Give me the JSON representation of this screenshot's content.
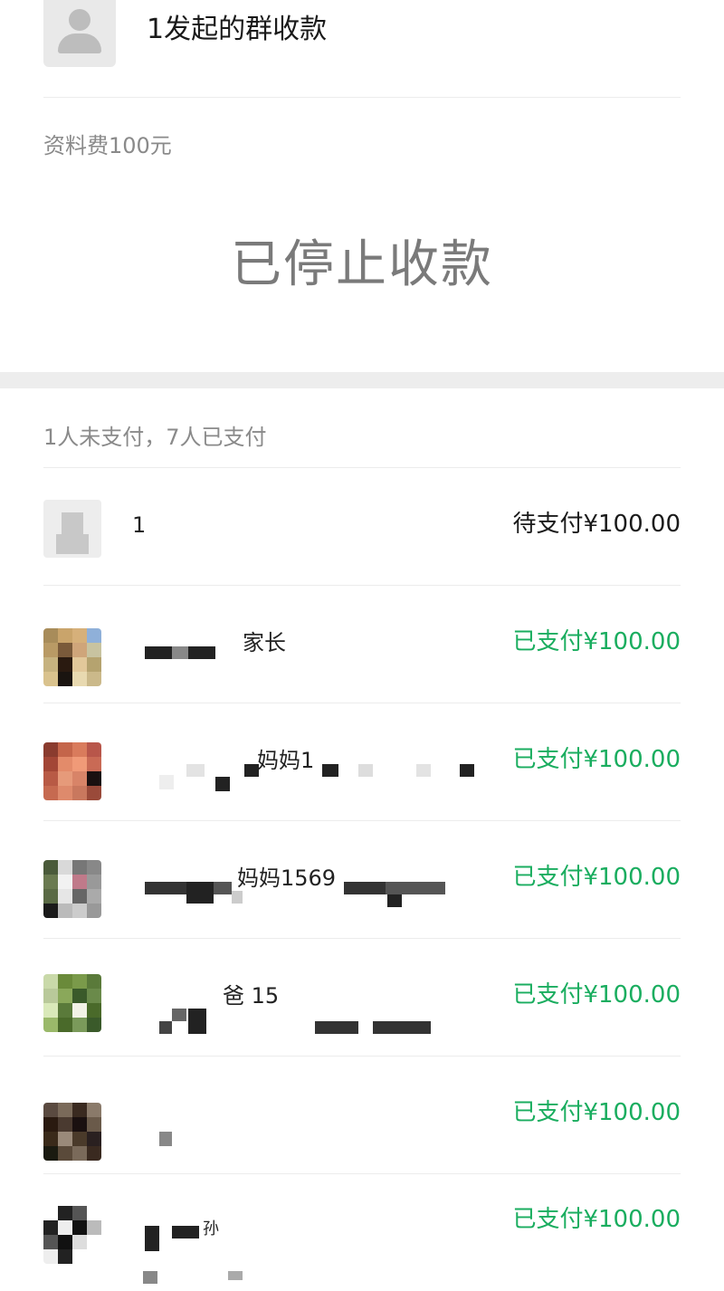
{
  "header": {
    "title": "1发起的群收款",
    "avatar_icon": "default-avatar-icon"
  },
  "collection": {
    "note": "资料费100元",
    "status": "已停止收款"
  },
  "summary": "1人未支付，7人已支付",
  "members": [
    {
      "name": "1",
      "amount": "待支付¥100.00",
      "state": "pending"
    },
    {
      "name": "家长",
      "amount": "已支付¥100.00",
      "state": "paid"
    },
    {
      "name": "妈妈1",
      "amount": "已支付¥100.00",
      "state": "paid"
    },
    {
      "name": "妈妈1569",
      "amount": "已支付¥100.00",
      "state": "paid"
    },
    {
      "name": "爸 15",
      "amount": "已支付¥100.00",
      "state": "paid"
    },
    {
      "name": "",
      "amount": "已支付¥100.00",
      "state": "paid"
    },
    {
      "name": "孙",
      "amount": "已支付¥100.00",
      "state": "paid"
    }
  ],
  "colors": {
    "paid": "#1aad5f",
    "pending": "#1a1a1a",
    "muted": "#8a8a8a"
  }
}
